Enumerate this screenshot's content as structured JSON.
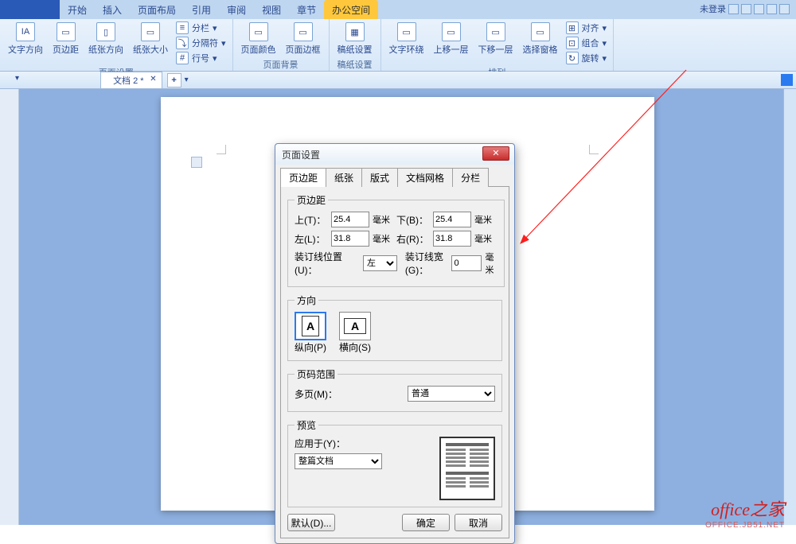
{
  "menu": {
    "tabs": [
      "开始",
      "插入",
      "页面布局",
      "引用",
      "审阅",
      "视图",
      "章节",
      "办公空间"
    ],
    "active_index": 7,
    "right_status": "未登录"
  },
  "ribbon": {
    "groups": [
      {
        "label": "页面设置",
        "items": [
          "文字方向",
          "页边距",
          "纸张方向",
          "纸张大小"
        ],
        "mini": [
          "分栏",
          "分隔符",
          "行号"
        ]
      },
      {
        "label": "页面背景",
        "items": [
          "页面颜色",
          "页面边框"
        ]
      },
      {
        "label": "稿纸设置",
        "items": [
          "稿纸设置"
        ]
      },
      {
        "label": "排列",
        "items": [
          "文字环绕",
          "上移一层",
          "下移一层",
          "选择窗格"
        ],
        "mini": [
          "对齐",
          "组合",
          "旋转"
        ]
      }
    ]
  },
  "doc_tab": {
    "name": "文档 2 *"
  },
  "dialog": {
    "title": "页面设置",
    "tabs": [
      "页边距",
      "纸张",
      "版式",
      "文档网格",
      "分栏"
    ],
    "active_tab": 0,
    "margins": {
      "legend": "页边距",
      "top_label": "上(T)：",
      "top_value": "25.4",
      "bottom_label": "下(B)：",
      "bottom_value": "25.4",
      "left_label": "左(L)：",
      "left_value": "31.8",
      "right_label": "右(R)：",
      "right_value": "31.8",
      "unit": "毫米",
      "gutter_pos_label": "装订线位置(U)：",
      "gutter_pos_value": "左",
      "gutter_w_label": "装订线宽(G)：",
      "gutter_w_value": "0"
    },
    "orientation": {
      "legend": "方向",
      "portrait": "纵向(P)",
      "landscape": "横向(S)"
    },
    "pages": {
      "legend": "页码范围",
      "multi_label": "多页(M)：",
      "multi_value": "普通"
    },
    "preview": {
      "legend": "预览",
      "apply_label": "应用于(Y)：",
      "apply_value": "整篇文档"
    },
    "buttons": {
      "default": "默认(D)...",
      "ok": "确定",
      "cancel": "取消"
    }
  },
  "watermark": {
    "line1": "office之家",
    "line2": "OFFICE.JB51.NET"
  }
}
